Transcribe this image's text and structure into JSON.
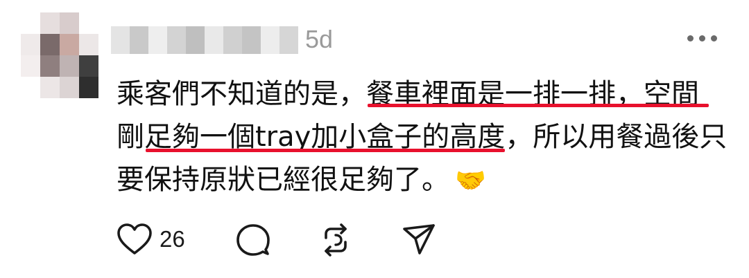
{
  "post": {
    "timestamp": "5d",
    "lines": [
      {
        "before": "乘客們不知道的是，",
        "underlined": "餐車裡面是一排一排，空間",
        "after": ""
      },
      {
        "before": "剛",
        "underlined": "足夠一個tray加小盒子的高度",
        "after": "，所以用餐過後只"
      },
      {
        "before": "要保持原狀已經很足夠了。",
        "underlined": "",
        "after": ""
      }
    ],
    "emoji": "🤝",
    "underline_color": "#e8112d"
  },
  "actions": {
    "like_count": "26",
    "icons": [
      "heart-icon",
      "comment-icon",
      "repost-icon",
      "share-icon"
    ]
  }
}
